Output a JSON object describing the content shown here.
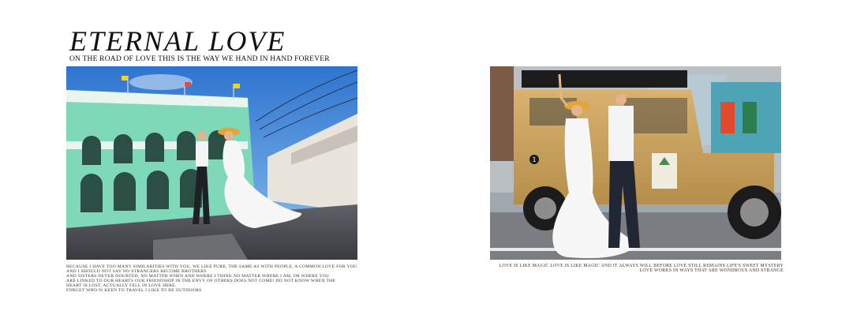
{
  "header": {
    "title": "ETERNAL LOVE",
    "subtitle": "ON THE ROAD OF LOVE THIS IS THE WAY WE HAND IN HAND FOREVER"
  },
  "caption_left": {
    "lines": [
      "Because I have too many similarities with you, we like pure, the same as with people,  a common love for you",
      "and I should not say no strangers become brothers",
      "and sisters.Never doubted, no matter when and where I think no matter where I am, or where you",
      "are linked to our hearts our friendship in the envy of others does not come! do not know when the",
      "heart is lost, Actually fell in love here.",
      "forget who is keen to travel I like to be outdoors"
    ]
  },
  "caption_right": {
    "lines": [
      "Love is like magic  Love is like magic  and it always will before love still remains  life's sweet mystery",
      "Love works in ways  that are wondrous and strange"
    ]
  },
  "photos": {
    "left": {
      "subject": "couple-walking-street-colonial-building"
    },
    "right": {
      "subject": "couple-posing-by-vintage-jeep",
      "badge_number": "1"
    }
  },
  "colors": {
    "sky": "#3d7fd1",
    "building": "#7fd9b8",
    "jeep": "#c9a15d"
  }
}
